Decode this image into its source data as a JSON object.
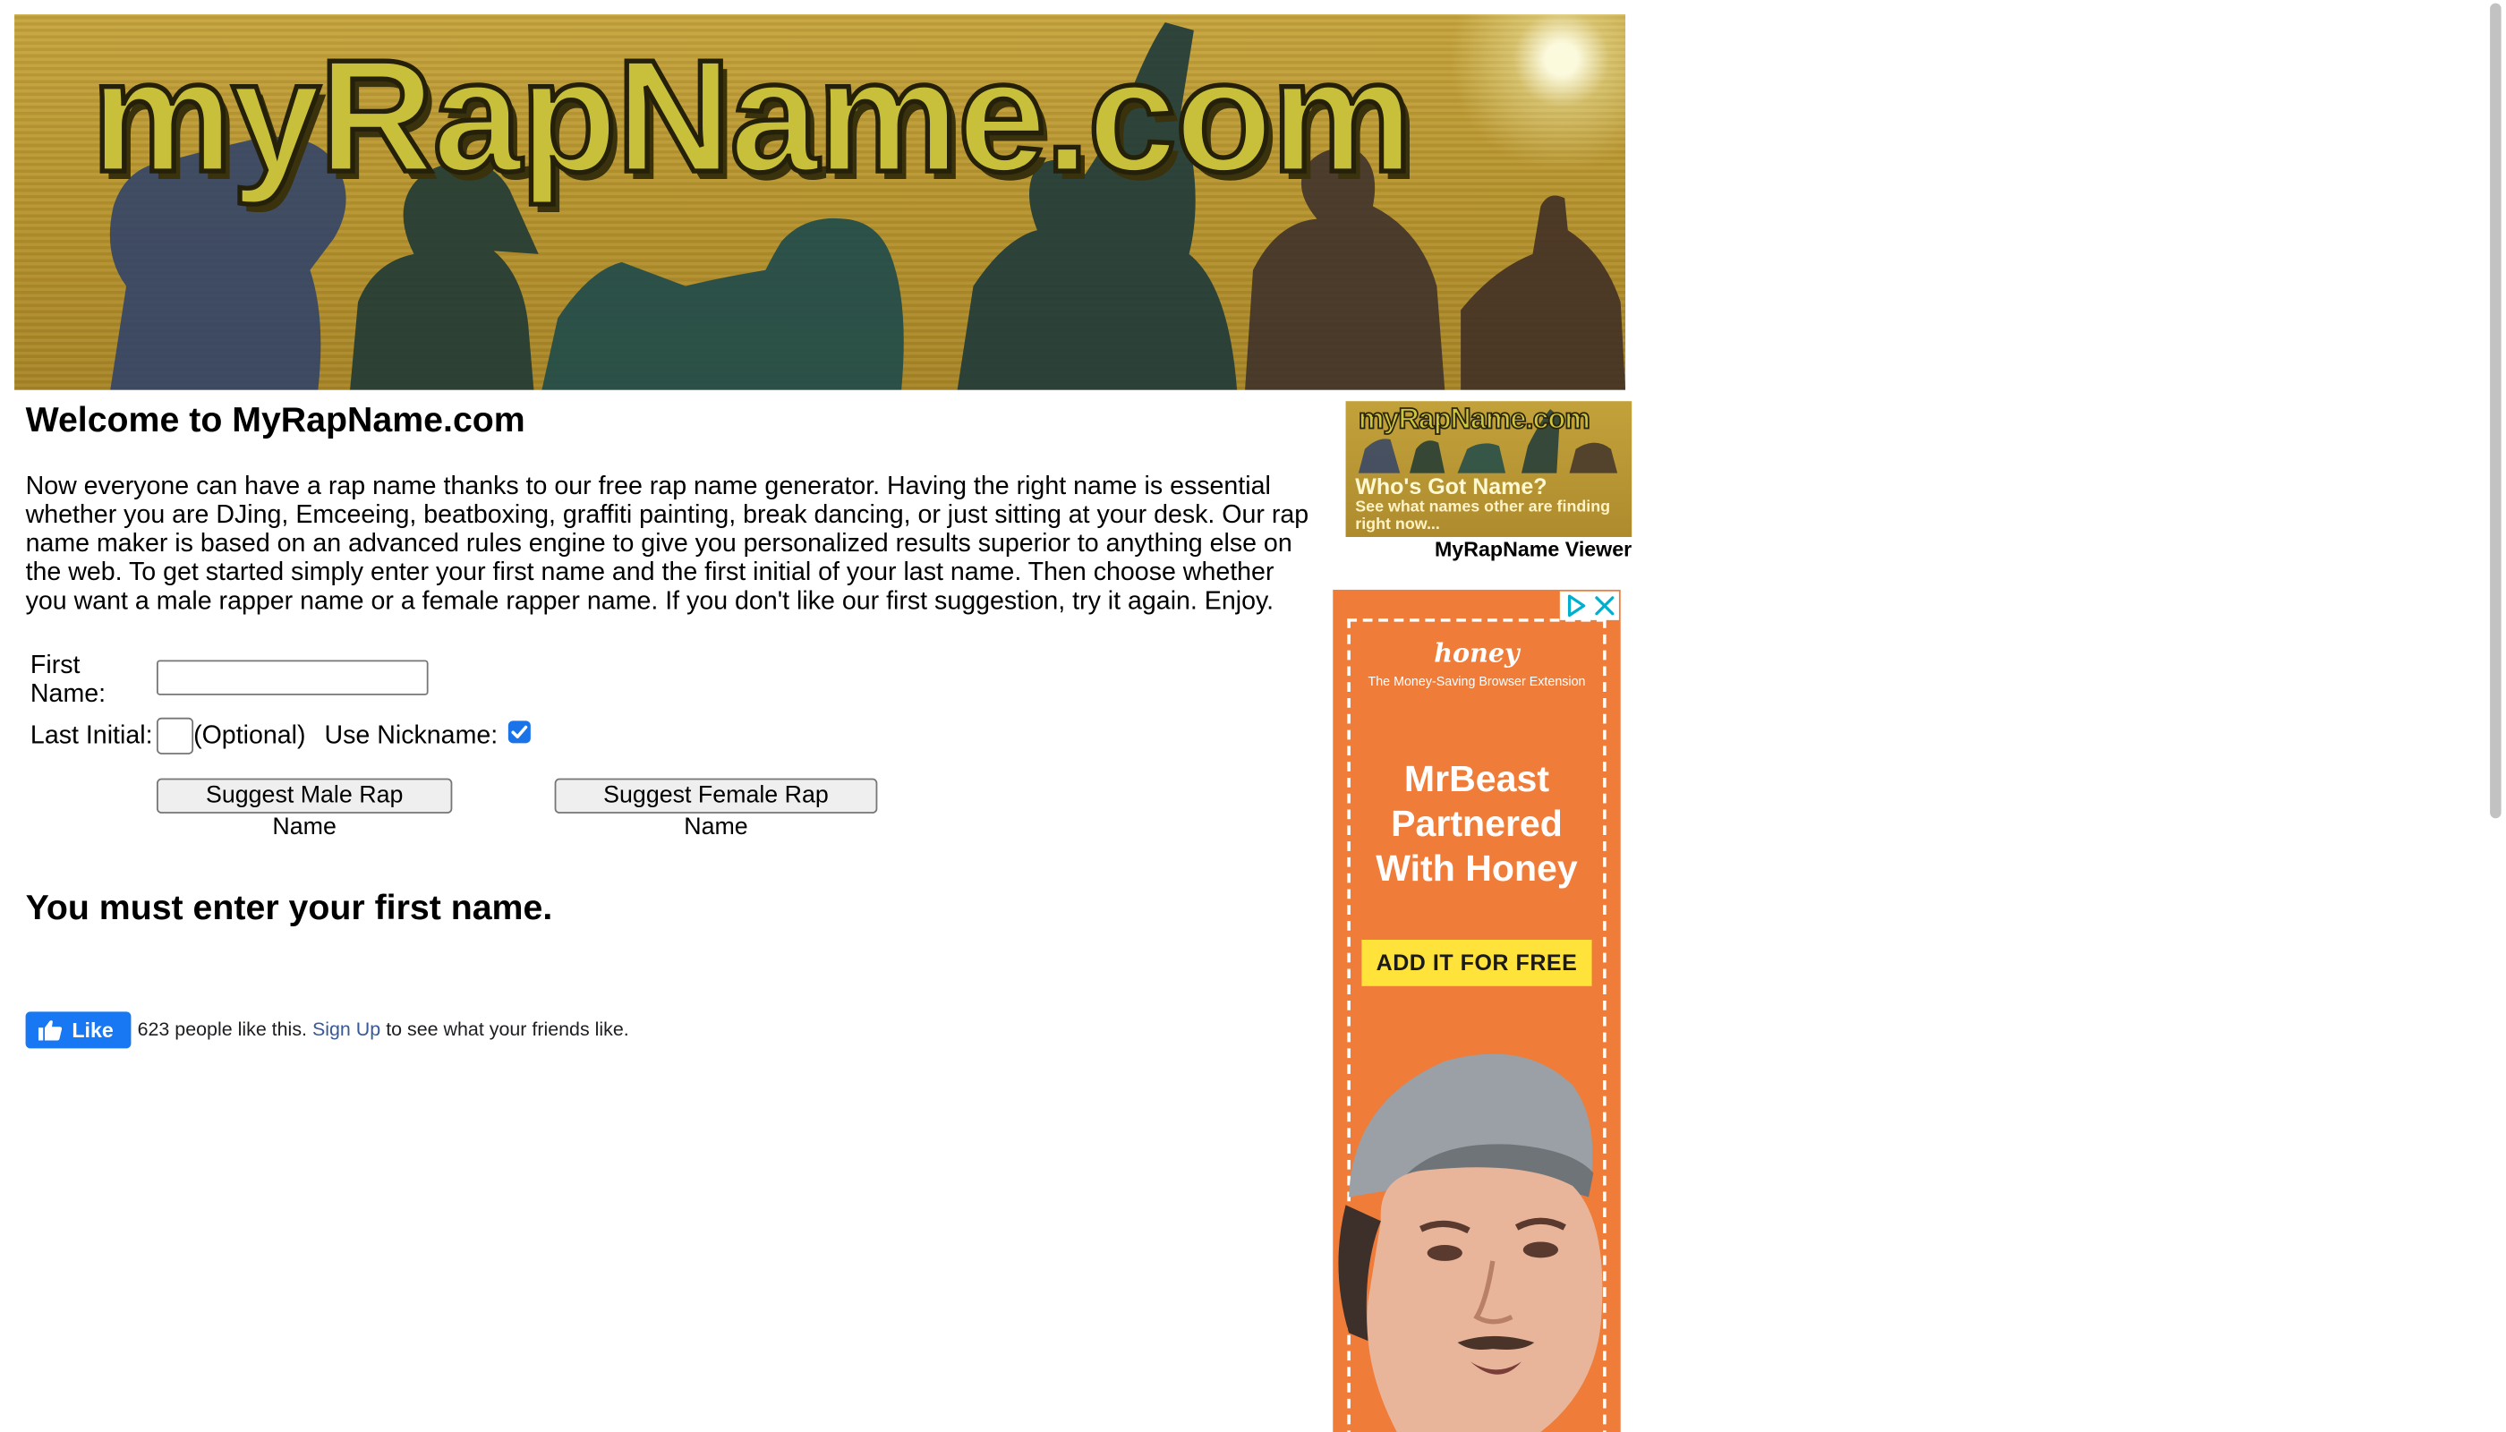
{
  "banner": {
    "logo_text": "myRapName.com"
  },
  "main": {
    "title": "Welcome to MyRapName.com",
    "intro": "Now everyone can have a rap name thanks to our free rap name generator. Having the right name is essential whether you are DJing, Emceeing, beatboxing, graffiti painting, break dancing, or just sitting at your desk. Our rap name maker is based on an advanced rules engine to give you personalized results superior to anything else on the web. To get started simply enter your first name and the first initial of your last name. Then choose whether you want a male rapper name or a female rapper name. If you don't like our first suggestion, try it again. Enjoy."
  },
  "form": {
    "first_name_label_line1": "First",
    "first_name_label_line2": "Name:",
    "first_name_value": "",
    "last_initial_label": "Last Initial:",
    "last_initial_value": "",
    "optional_label": "(Optional)",
    "nickname_label": "Use Nickname:",
    "nickname_checked": true,
    "male_button": "Suggest Male Rap Name",
    "female_button": "Suggest Female Rap Name"
  },
  "error_message": "You must enter your first name.",
  "facebook": {
    "like_label": "Like",
    "count_text": "623 people like this.",
    "signup_link": "Sign Up",
    "suffix_text": "to see what your friends like.",
    "brand_color": "#1877f2"
  },
  "sidebar": {
    "viewer_thumb_logo": "myRapName.com",
    "viewer_thumb_line1": "Who's Got Name?",
    "viewer_thumb_line2": "See what names other are finding right now...",
    "viewer_caption": "MyRapName Viewer"
  },
  "ad": {
    "brand": "honey",
    "tagline": "The Money-Saving Browser Extension",
    "headline_line1": "MrBeast",
    "headline_line2": "Partnered",
    "headline_line3": "With Honey",
    "cta": "ADD IT FOR FREE",
    "background_color": "#ef7c38",
    "cta_color": "#ffe23a",
    "icons": [
      "adchoices-icon",
      "close-icon"
    ]
  }
}
